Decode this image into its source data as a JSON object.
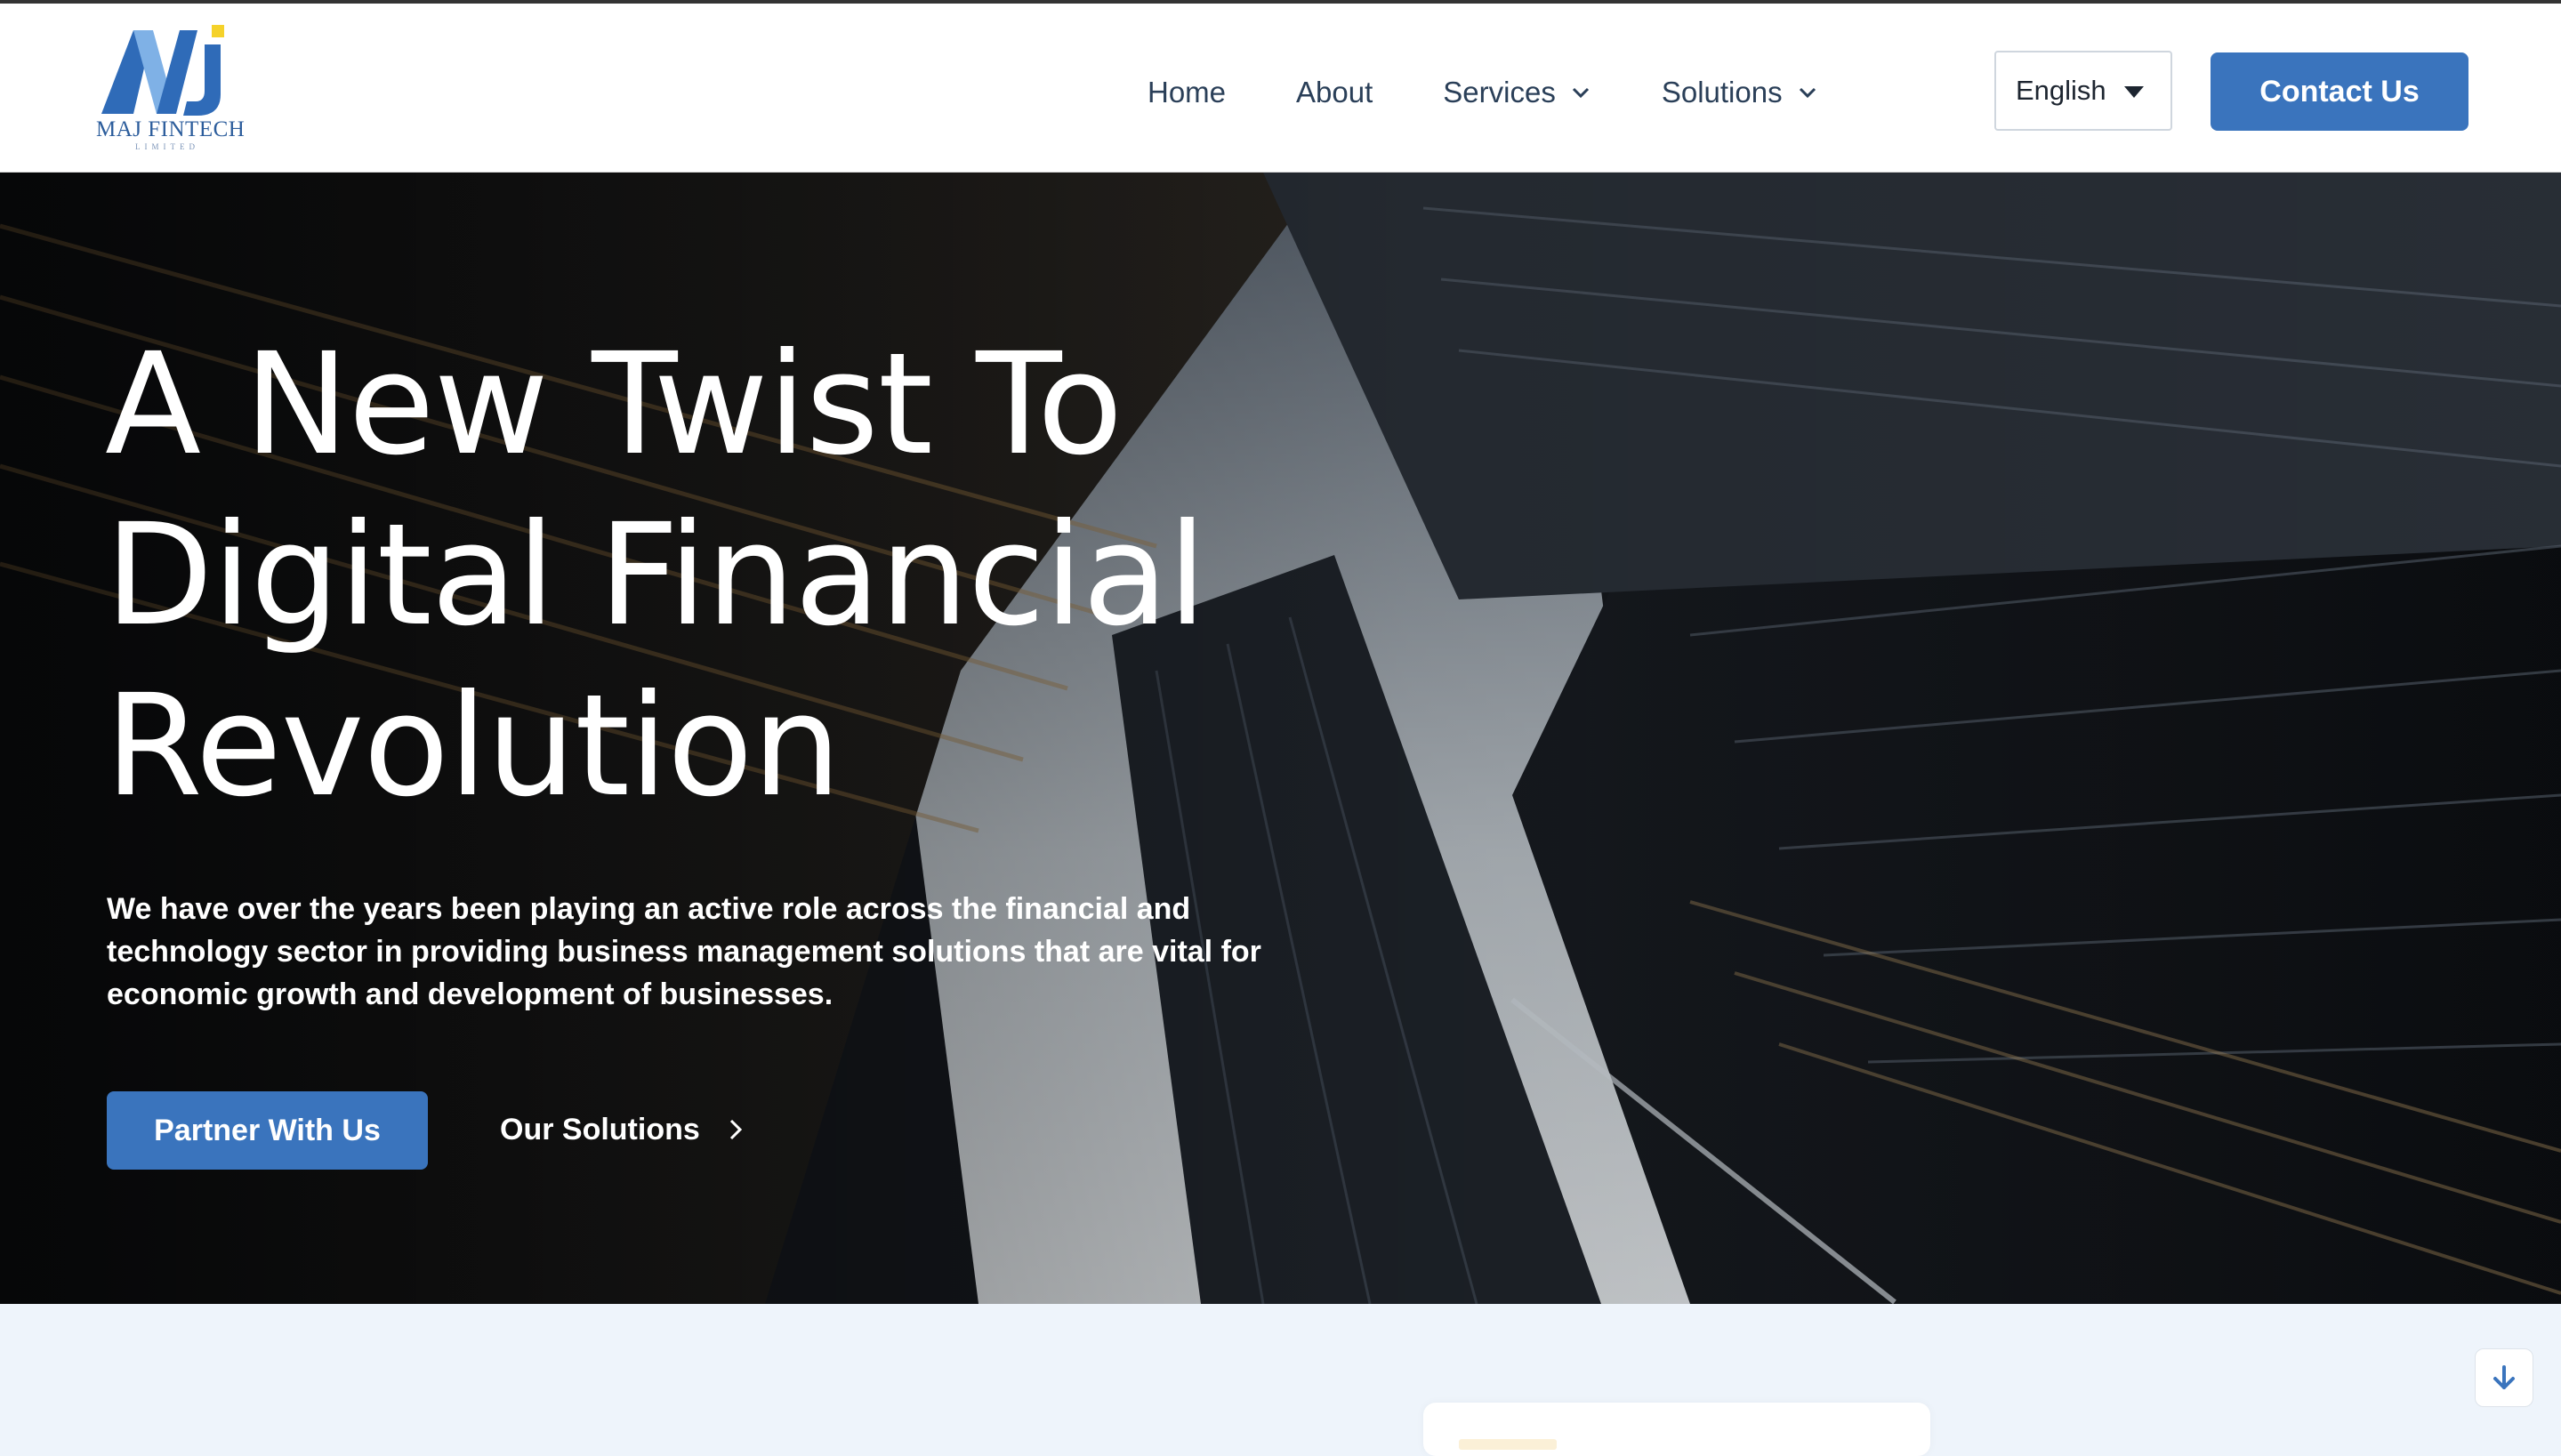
{
  "header": {
    "logo": {
      "text": "MAJ FINTECH",
      "subtext": "LIMITED"
    },
    "nav": [
      {
        "label": "Home",
        "dropdown": false
      },
      {
        "label": "About",
        "dropdown": false
      },
      {
        "label": "Services",
        "dropdown": true
      },
      {
        "label": "Solutions",
        "dropdown": true
      }
    ],
    "language": {
      "selected": "English"
    },
    "contact_label": "Contact Us"
  },
  "hero": {
    "title_lines": [
      "A New Twist To",
      "Digital Financial",
      "Revolution"
    ],
    "description": "We have over the years been playing an active role across the financial and technology sector in providing business management solutions that are vital for economic growth and development of businesses.",
    "partner_label": "Partner With Us",
    "solutions_label": "Our Solutions"
  },
  "icons": {
    "nav_dropdown": "chevron-down-icon",
    "language": "caret-down-icon",
    "solutions_link": "chevron-right-icon",
    "scroll": "arrow-down-icon"
  },
  "colors": {
    "accent": "#3a74bd",
    "nav_text": "#2a3f58",
    "logo_yellow": "#f5d22a",
    "logo_blue": "#2f6bb8",
    "section_bg": "#eef4fb"
  }
}
